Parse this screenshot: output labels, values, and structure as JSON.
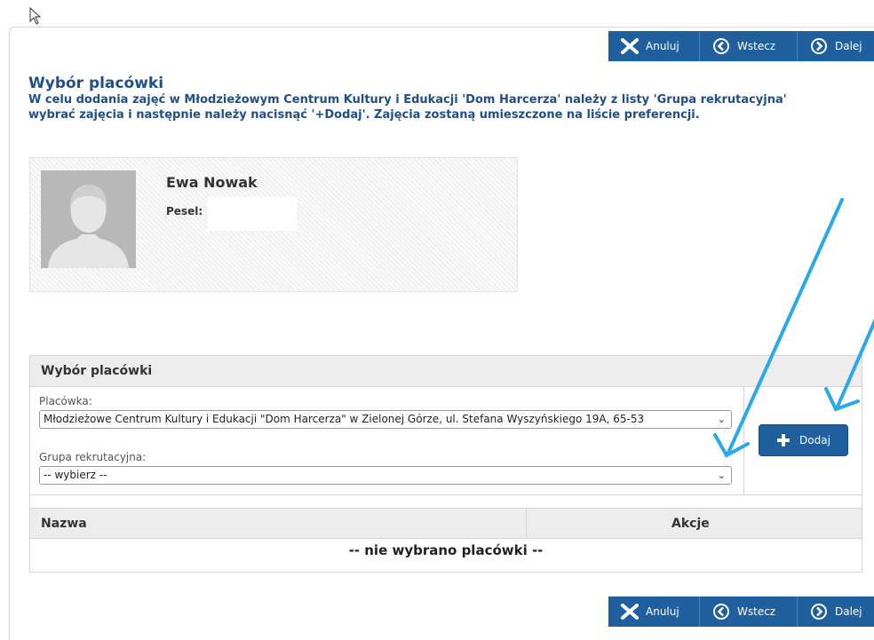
{
  "toolbar": {
    "cancel_label": "Anuluj",
    "back_label": "Wstecz",
    "next_label": "Dalej"
  },
  "heading": {
    "title": "Wybór placówki",
    "instructions": "W celu dodania zajęć w Młodzieżowym Centrum Kultury i Edukacji 'Dom Harcerza' należy z listy 'Grupa rekrutacyjna' wybrać zajęcia i następnie należy nacisnąć '+Dodaj'. Zajęcia zostaną umieszczone na liście preferencji."
  },
  "profile": {
    "name": "Ewa Nowak",
    "pesel_label": "Pesel:",
    "pesel_value": ""
  },
  "selection": {
    "panel_title": "Wybór placówki",
    "facility_label": "Placówka:",
    "facility_value": "Młodzieżowe Centrum Kultury i Edukacji \"Dom Harcerza\" w Zielonej Górze, ul. Stefana Wyszyńskiego 19A, 65-53",
    "group_label": "Grupa rekrutacyjna:",
    "group_value": "-- wybierz --",
    "add_label": "Dodaj"
  },
  "table": {
    "columns": [
      "Nazwa",
      "Akcje"
    ],
    "empty_text": "-- nie wybrano placówki --"
  },
  "colors": {
    "toolbar_bg": "#1f5f9e",
    "heading": "#1f4f8a",
    "annotation_arrow": "#29a9e8"
  }
}
